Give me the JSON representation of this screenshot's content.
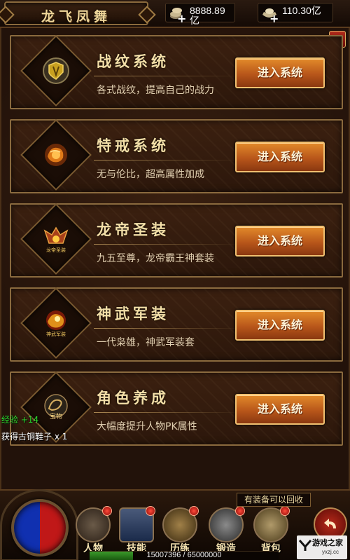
{
  "header": {
    "title": "龙飞凤舞",
    "currency": [
      {
        "icon": "coin-pile-icon",
        "amount": "8888.89亿"
      },
      {
        "icon": "ingot-icon",
        "amount": "110.30亿"
      }
    ]
  },
  "panel": {
    "close_label": "×",
    "cards": [
      {
        "title": "战纹系统",
        "desc": "各式战纹，提高自己的战力",
        "button": "进入系统",
        "icon": "war-pattern-shield-icon"
      },
      {
        "title": "特戒系统",
        "desc": "无与伦比，超高属性加成",
        "button": "进入系统",
        "icon": "special-ring-icon"
      },
      {
        "title": "龙帝圣装",
        "desc": "九五至尊，龙帝霸王神套装",
        "button": "进入系统",
        "icon": "dragon-emperor-armor-icon",
        "icon_text": "龙帝圣装"
      },
      {
        "title": "神武军装",
        "desc": "一代枭雄，神武军装套",
        "button": "进入系统",
        "icon": "divine-armor-icon",
        "icon_text": "神武军装"
      },
      {
        "title": "角色养成",
        "desc": "大幅度提升人物PK属性",
        "button": "进入系统",
        "icon": "treasure-dragon-icon",
        "icon_text": "宝物"
      }
    ]
  },
  "messages": {
    "exp": "经验 +14",
    "item": "获得古铜鞋子 x 1"
  },
  "hud": {
    "notice": "有装备可以回收",
    "skills": [
      {
        "label": "人物",
        "icon": "character-icon",
        "alert": true
      },
      {
        "label": "技能",
        "icon": "skill-book-icon",
        "alert": true
      },
      {
        "label": "历练",
        "icon": "training-icon",
        "alert": true
      },
      {
        "label": "锻造",
        "icon": "anvil-icon",
        "alert": true
      },
      {
        "label": "背包",
        "icon": "bag-icon",
        "alert": true
      }
    ],
    "exp_text": "15007396 / 65000000",
    "exp_fraction": 0.231,
    "watermark": {
      "main": "游戏之家",
      "url": "yxzj.cc"
    }
  },
  "colors": {
    "button": "#c46a1e",
    "title": "#f3dfa8",
    "exp_green": "#2ee02e",
    "alert_red": "#d81a10"
  }
}
